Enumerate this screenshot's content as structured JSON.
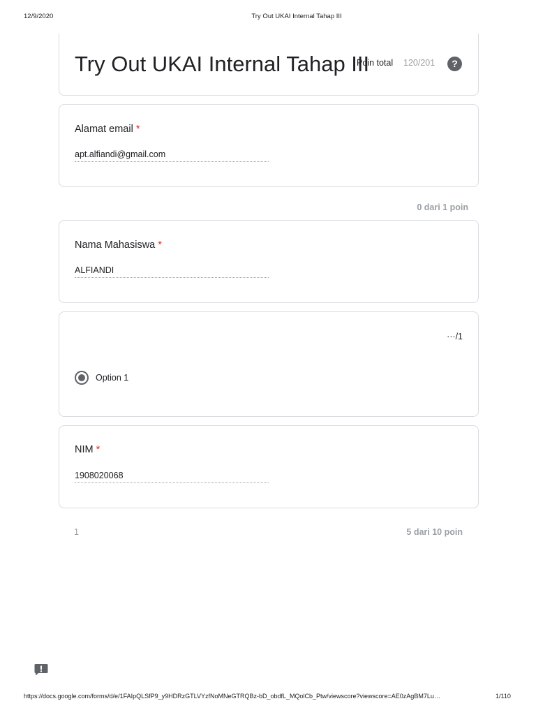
{
  "print_header": {
    "date": "12/9/2020",
    "title": "Try Out UKAI Internal Tahap III"
  },
  "form": {
    "title": "Try Out UKAI Internal Tahap III",
    "score_label": "Poin total",
    "score_value": "120/201",
    "help_icon": "?"
  },
  "questions": [
    {
      "title": "Alamat email",
      "required_mark": "*",
      "answer": "apt.alfiandi@gmail.com"
    },
    {
      "title": "Nama Mahasiswa",
      "required_mark": "*",
      "answer": "ALFIANDI"
    },
    {
      "score": "···/1",
      "option_label": "Option 1"
    },
    {
      "title": "NIM",
      "required_mark": "*",
      "answer": "1908020068"
    }
  ],
  "section_points": [
    {
      "label": "0 dari 1 poin"
    },
    {
      "number": "1",
      "label": "5 dari 10 poin"
    }
  ],
  "icons": {
    "help": "help-circle-icon",
    "feedback": "feedback-icon"
  },
  "print_footer": {
    "url": "https://docs.google.com/forms/d/e/1FAIpQLSfP9_y9HDRzGTLVYzfNoMNeGTRQBz-bD_obdfL_MQolCb_Ptw/viewscore?viewscore=AE0zAgBM7Lu…",
    "page": "1/110"
  }
}
